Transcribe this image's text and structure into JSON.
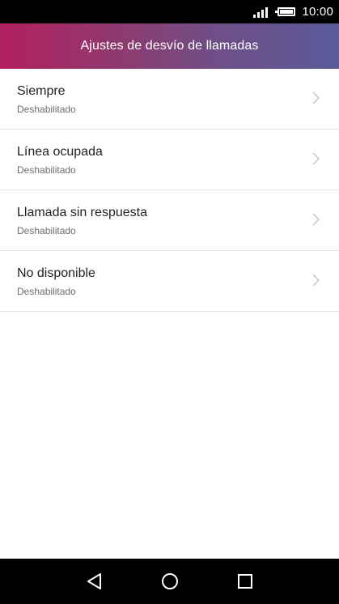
{
  "status_bar": {
    "time": "10:00",
    "icons": [
      "signal-icon",
      "battery-icon"
    ]
  },
  "header": {
    "title": "Ajustes de desvío de llamadas"
  },
  "list": {
    "items": [
      {
        "title": "Siempre",
        "subtitle": "Deshabilitado"
      },
      {
        "title": "Línea ocupada",
        "subtitle": "Deshabilitado"
      },
      {
        "title": "Llamada sin respuesta",
        "subtitle": "Deshabilitado"
      },
      {
        "title": "No disponible",
        "subtitle": "Deshabilitado"
      }
    ]
  },
  "nav_bar": {
    "icons": [
      "back-icon",
      "home-icon",
      "recents-icon"
    ]
  },
  "colors": {
    "header_gradient_start": "#b3205f",
    "header_gradient_end": "#5a5a9a",
    "title_text": "#222222",
    "subtitle_text": "#6d6d6d",
    "divider": "#e4e4e4"
  }
}
